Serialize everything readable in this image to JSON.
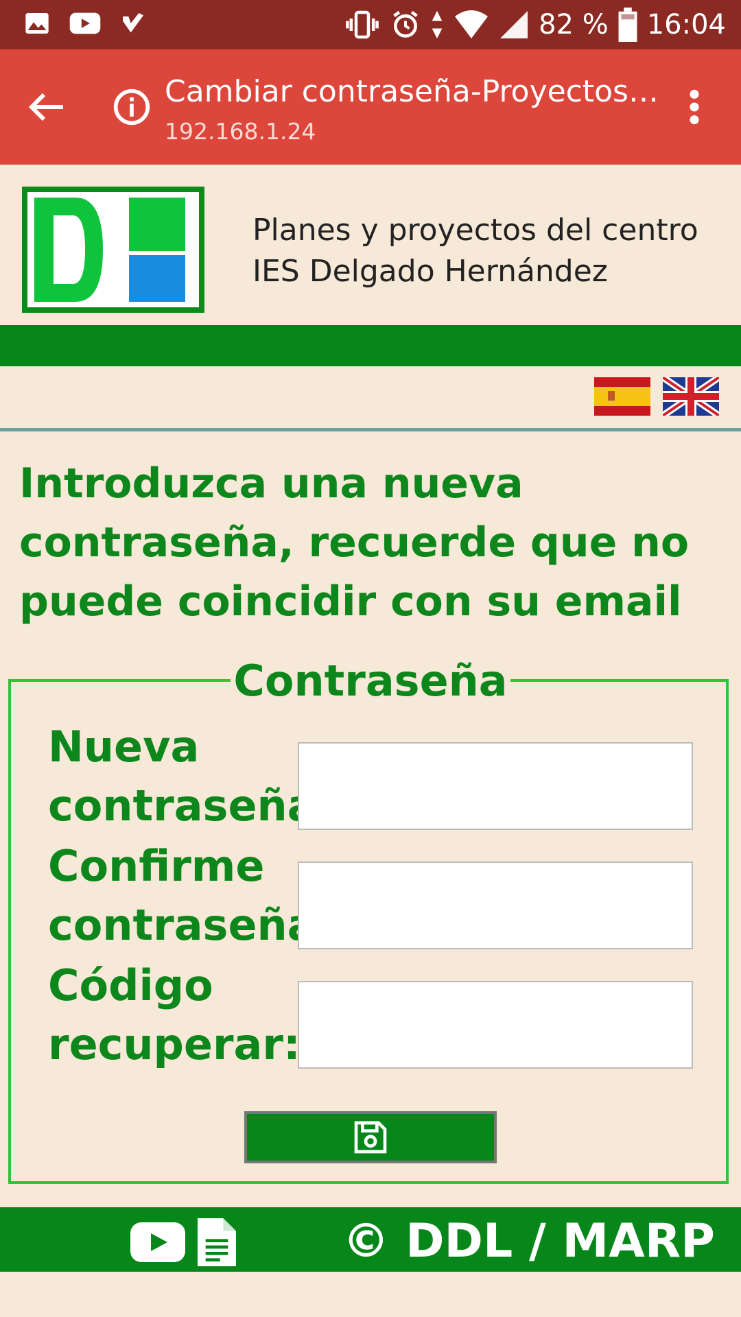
{
  "status_bar": {
    "battery": "82 %",
    "time": "16:04",
    "icons": [
      "image-icon",
      "youtube-icon",
      "checkmark-icon",
      "vibrate-icon",
      "alarm-icon",
      "data-arrows-icon",
      "wifi-icon",
      "signal-icon",
      "battery-icon"
    ]
  },
  "browser": {
    "title": "Cambiar contraseña-Proyectos…",
    "url": "192.168.1.24"
  },
  "header": {
    "site_title_line1": "Planes y proyectos del centro",
    "site_title_line2": "IES Delgado Hernández",
    "logo_text": "DH"
  },
  "languages": [
    "Español",
    "English"
  ],
  "intro": "Introduzca una nueva contraseña, recuerde que no puede coincidir con su email",
  "form": {
    "legend": "Contraseña",
    "fields": [
      {
        "label": "Nueva contraseña:",
        "value": ""
      },
      {
        "label": "Confirme contraseña:",
        "value": ""
      },
      {
        "label": "Código recuperar:",
        "value": ""
      }
    ]
  },
  "footer": {
    "copyright": "© DDL / MARP"
  },
  "colors": {
    "status_bar": "#8a2a22",
    "toolbar": "#dd463b",
    "page_bg": "#f7e9d8",
    "accent_green": "#07871a",
    "text_green": "#0d861b",
    "fieldset_border": "#33c23b"
  }
}
